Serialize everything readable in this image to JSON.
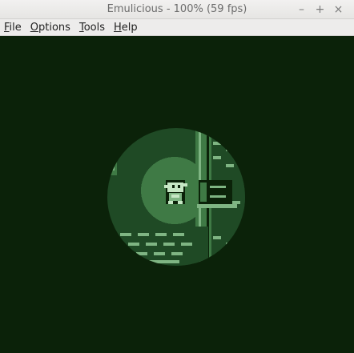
{
  "window": {
    "title": "Emulicious - 100% (59 fps)",
    "controls": [
      "–",
      "+",
      "×"
    ]
  },
  "menu": [
    {
      "mnemonic": "F",
      "rest": "ile"
    },
    {
      "mnemonic": "O",
      "rest": "ptions"
    },
    {
      "mnemonic": "T",
      "rest": "ools"
    },
    {
      "mnemonic": "H",
      "rest": "elp"
    }
  ],
  "palette": {
    "darkest": "#0b2209",
    "dark": "#1f4a25",
    "mid": "#3f7a45",
    "light": "#7fb583",
    "lightest": "#c6e7c4"
  },
  "icons": {
    "minimize": "minimize-icon",
    "maximize": "maximize-icon",
    "close": "close-icon"
  }
}
